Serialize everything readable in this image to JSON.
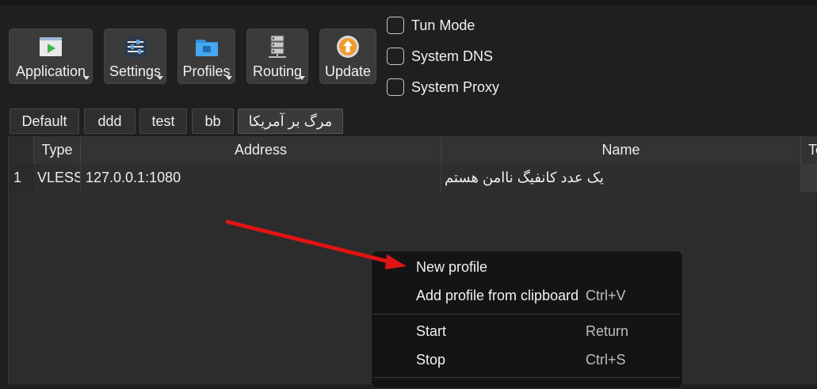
{
  "toolbar": {
    "buttons": [
      {
        "label": "Application",
        "icon": "application-icon"
      },
      {
        "label": "Settings",
        "icon": "settings-sliders-icon"
      },
      {
        "label": "Profiles",
        "icon": "folder-icon"
      },
      {
        "label": "Routing",
        "icon": "server-icon"
      },
      {
        "label": "Update",
        "icon": "update-arrow-icon"
      }
    ]
  },
  "options": {
    "tun_mode": "Tun Mode",
    "system_dns": "System DNS",
    "system_proxy": "System Proxy"
  },
  "tabs": [
    "Default",
    "ddd",
    "test",
    "bb",
    "مرگ بر آمریکا"
  ],
  "table": {
    "columns": [
      "Type",
      "Address",
      "Name",
      "Te"
    ],
    "rows": [
      {
        "index": "1",
        "type": "VLESS",
        "address": "127.0.0.1:1080",
        "name": "یک عدد کانفیگ ناامن هستم"
      }
    ]
  },
  "context_menu": {
    "items": [
      {
        "label": "New profile",
        "shortcut": ""
      },
      {
        "label": "Add profile from clipboard",
        "shortcut": "Ctrl+V"
      },
      {
        "label": "Start",
        "shortcut": "Return"
      },
      {
        "label": "Stop",
        "shortcut": "Ctrl+S"
      }
    ]
  },
  "colors": {
    "background": "#1f1f1f",
    "toolbar_button": "#3b3b3b",
    "menu_background": "#141414",
    "annotation_arrow": "#e01414"
  }
}
